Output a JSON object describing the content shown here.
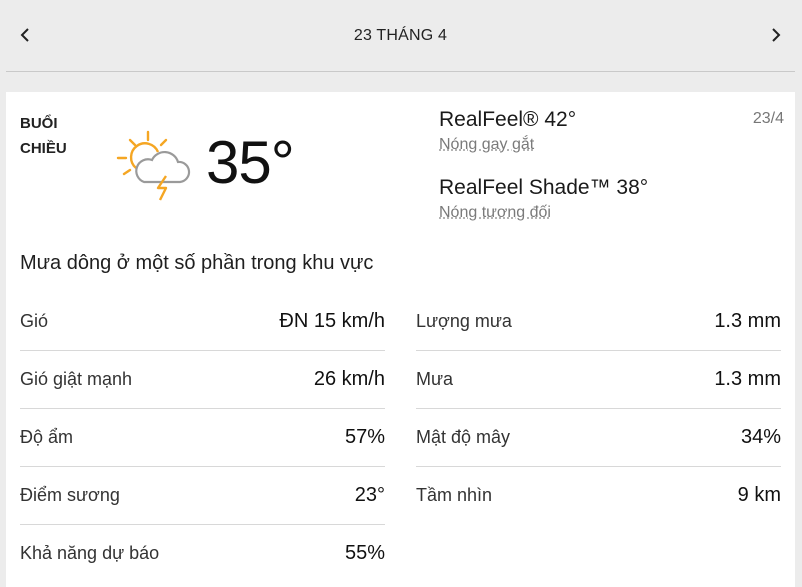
{
  "header": {
    "date_title": "23 THÁNG 4",
    "prev_icon": "chevron-left-icon",
    "next_icon": "chevron-right-icon"
  },
  "current": {
    "period_line1": "BUỔI",
    "period_line2": "CHIỀU",
    "icon": "partly-sunny-thunderstorm-icon",
    "temperature": "35°",
    "realfeel": "RealFeel® 42°",
    "realfeel_phrase": "Nóng gay gắt",
    "realfeel_shade": "RealFeel Shade™ 38°",
    "realfeel_shade_phrase": "Nóng tương đối",
    "date_short": "23/4",
    "phrase": "Mưa dông ở một số phần trong khu vực"
  },
  "details_left": [
    {
      "label": "Gió",
      "value": "ĐN 15 km/h"
    },
    {
      "label": "Gió giật mạnh",
      "value": "26 km/h"
    },
    {
      "label": "Độ ẩm",
      "value": "57%"
    },
    {
      "label": "Điểm sương",
      "value": "23°"
    },
    {
      "label": "Khả năng dự báo",
      "value": "55%"
    }
  ],
  "details_right": [
    {
      "label": "Lượng mưa",
      "value": "1.3 mm"
    },
    {
      "label": "Mưa",
      "value": "1.3 mm"
    },
    {
      "label": "Mật độ mây",
      "value": "34%"
    },
    {
      "label": "Tầm nhìn",
      "value": "9 km"
    }
  ],
  "colors": {
    "sun": "#f5a623",
    "bolt": "#f5a623",
    "cloud_stroke": "#9a9a9a",
    "background": "#ececec",
    "card": "#ffffff"
  }
}
